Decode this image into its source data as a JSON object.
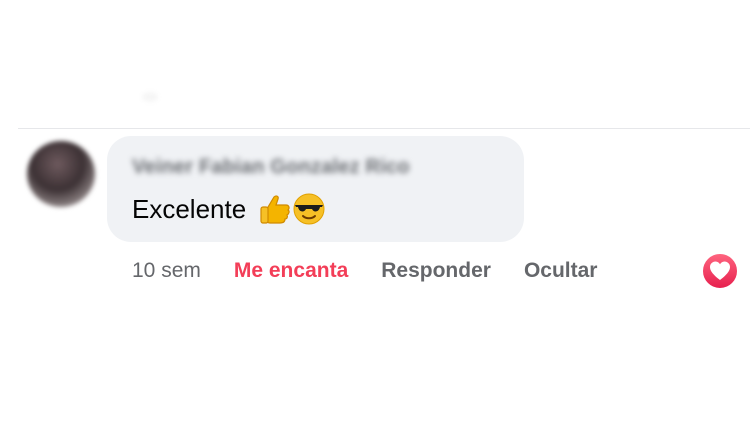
{
  "comment": {
    "author": "Veiner Fabian Gonzalez Rico",
    "text": "Excelente",
    "emojis": [
      "thumbs-up",
      "smiling-face-with-sunglasses"
    ]
  },
  "actions": {
    "time": "10 sem",
    "reaction": "Me encanta",
    "reply": "Responder",
    "hide": "Ocultar"
  },
  "colors": {
    "reaction_active": "#f33e58",
    "bubble_bg": "#f0f2f5",
    "secondary_text": "#65676b"
  },
  "reaction_icon": "heart-reaction-icon"
}
